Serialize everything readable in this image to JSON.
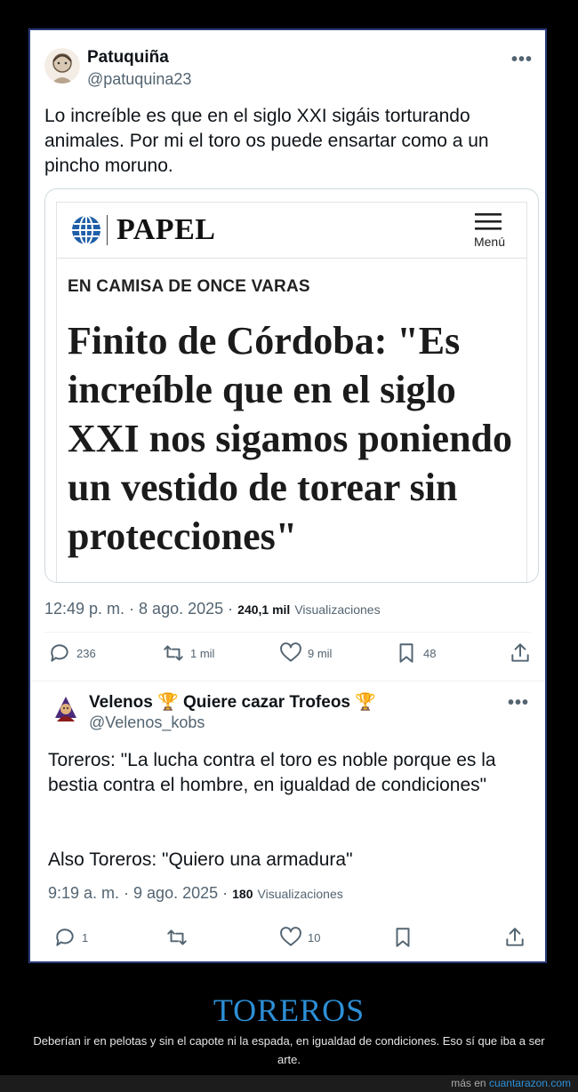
{
  "tweet1": {
    "display_name": "Patuquiña",
    "handle": "@patuquina23",
    "more": "•••",
    "text": "Lo increíble es que en el siglo XXI sigáis torturando animales. Por mi el toro os puede ensartar como a un pincho moruno.",
    "card": {
      "logo": "PAPEL",
      "menu_label": "Menú",
      "section": "EN CAMISA DE ONCE VARAS",
      "headline": "Finito de Córdoba: \"Es increíble que en el siglo XXI nos sigamos poniendo un vestido de torear sin protecciones\""
    },
    "time": "12:49 p. m. · 8 ago. 2025 ·",
    "views_count": "240,1 mil",
    "views_label": "Visualizaciones",
    "actions": {
      "replies": "236",
      "retweets": "1 mil",
      "likes": "9 mil",
      "bookmarks": "48"
    }
  },
  "tweet2": {
    "display_name": "Velenos 🏆 Quiere cazar Trofeos 🏆",
    "handle": "@Velenos_kobs",
    "more": "•••",
    "text_line1": "Toreros: \"La lucha contra el toro es noble porque es la bestia contra el hombre, en igualdad de condiciones\"",
    "text_line2": "Also Toreros: \"Quiero una armadura\"",
    "time": "9:19 a. m. · 9 ago. 2025 ·",
    "views_count": "180",
    "views_label": "Visualizaciones",
    "actions": {
      "replies": "1",
      "retweets": "",
      "likes": "10",
      "bookmarks": ""
    }
  },
  "caption": {
    "title": "TOREROS",
    "text": "Deberían ir en pelotas y sin el capote ni la espada, en igualdad de condiciones. Eso sí que iba a ser arte."
  },
  "footer": {
    "prefix": "más en",
    "site": "cuantarazon.com"
  },
  "colors": {
    "caption_title": "#2d8fd6",
    "frame_border": "#2a3b7a",
    "secondary_text": "#536471"
  }
}
